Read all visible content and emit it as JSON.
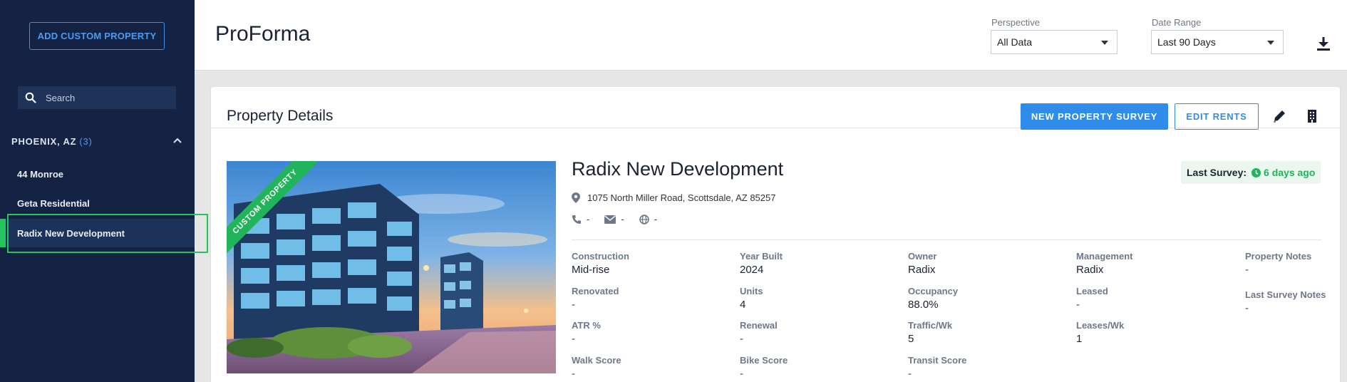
{
  "sidebar": {
    "add_button": "ADD CUSTOM PROPERTY",
    "search_placeholder": "Search",
    "group": {
      "title": "PHOENIX, AZ",
      "count": "(3)"
    },
    "properties": [
      {
        "label": "44 Monroe"
      },
      {
        "label": "Geta Residential"
      },
      {
        "label": "Radix New Development"
      }
    ]
  },
  "header": {
    "title": "ProForma",
    "perspective_label": "Perspective",
    "perspective_value": "All Data",
    "date_range_label": "Date Range",
    "date_range_value": "Last 90 Days"
  },
  "card": {
    "title": "Property Details",
    "new_survey_button": "NEW PROPERTY SURVEY",
    "edit_rents_button": "EDIT RENTS",
    "ribbon": "CUSTOM PROPERTY",
    "name": "Radix New Development",
    "address": "1075 North Miller Road, Scottsdale, AZ 85257",
    "phone": "-",
    "email": "-",
    "website": "-",
    "last_survey_label": "Last Survey:",
    "last_survey_value": "6 days ago",
    "fields": {
      "construction": {
        "k": "Construction",
        "v": "Mid-rise"
      },
      "year_built": {
        "k": "Year Built",
        "v": "2024"
      },
      "owner": {
        "k": "Owner",
        "v": "Radix"
      },
      "management": {
        "k": "Management",
        "v": "Radix"
      },
      "property_notes": {
        "k": "Property Notes",
        "v": "-"
      },
      "renovated": {
        "k": "Renovated",
        "v": "-"
      },
      "units": {
        "k": "Units",
        "v": "4"
      },
      "occupancy": {
        "k": "Occupancy",
        "v": "88.0%"
      },
      "leased": {
        "k": "Leased",
        "v": "-"
      },
      "last_survey_notes": {
        "k": "Last Survey Notes",
        "v": "-"
      },
      "atr": {
        "k": "ATR %",
        "v": "-"
      },
      "renewal": {
        "k": "Renewal",
        "v": "-"
      },
      "traffic": {
        "k": "Traffic/Wk",
        "v": "5"
      },
      "leases": {
        "k": "Leases/Wk",
        "v": "1"
      },
      "walk_score": {
        "k": "Walk Score",
        "v": "-"
      },
      "bike_score": {
        "k": "Bike Score",
        "v": "-"
      },
      "transit_score": {
        "k": "Transit Score",
        "v": "-"
      }
    }
  },
  "colors": {
    "sidebar_bg": "#142243",
    "accent_blue": "#2f8cea",
    "accent_green": "#21b45a"
  }
}
